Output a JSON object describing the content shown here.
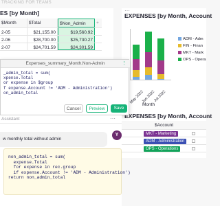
{
  "app": {
    "title": "TRACKING FOR TEAMS"
  },
  "left_panel": {
    "title": "ES [by Month]",
    "columns": [
      "$Month",
      "$Total",
      "$Non_Admin",
      "+"
    ],
    "rows": [
      {
        "month": "2-05",
        "total": "$21,155.00",
        "non_admin": "$19,560.92"
      },
      {
        "month": "2-06",
        "total": "$28,700.00",
        "non_admin": "$25,730.27"
      },
      {
        "month": "2-07",
        "total": "$24,701.59",
        "non_admin": "$24,301.59"
      }
    ]
  },
  "chart_panel": {
    "title": "EXPENSES [by Month, Account",
    "menu_icon": "more-dots-icon"
  },
  "chart_data": {
    "type": "bar",
    "categories": [
      "May 2022",
      "Jun 2022",
      "Jul 2022"
    ],
    "series": [
      {
        "name": "ADM - Adm",
        "color": "#74a7e0",
        "values": [
          1600,
          3000,
          400
        ]
      },
      {
        "name": "FIN - Finan",
        "color": "#e6bb2c",
        "values": [
          4000,
          4500,
          3000
        ]
      },
      {
        "name": "MKT - Mark",
        "color": "#a23a8a",
        "values": [
          6500,
          9000,
          8000
        ]
      },
      {
        "name": "OPS - Opera",
        "color": "#1bb04a",
        "values": [
          9000,
          12200,
          13300
        ]
      }
    ],
    "xlabel": "Month",
    "legend": "right"
  },
  "dialog": {
    "title": "Expenses_summary_Month.Non-Admin",
    "code_lines": [
      "_admin_total = sum(",
      "xpense.Total",
      "or expense in $group",
      "f expense.Account != 'ADM - Administration')",
      "on_admin_total"
    ],
    "cancel_label": "Cancel",
    "preview_label": "Preview",
    "save_label": "Save"
  },
  "accounts_panel": {
    "title": "EXPENSES [by Month, Account",
    "column": "$Account",
    "rows": [
      {
        "label": "MKT - Marketing",
        "color": "#7b3292"
      },
      {
        "label": "ADM - Administration",
        "color": "#3a4fb3"
      },
      {
        "label": "OPS - Operations",
        "color": "#12a35a"
      }
    ]
  },
  "assistant": {
    "header": "Assistant",
    "user_message": "w monthly total without admin",
    "avatar_initial": "Y",
    "code_lines": [
      "non_admin_total = sum(",
      "  expense.Total",
      "  for expense in rec.group",
      "  if expense.Account != 'ADM - Administration')",
      "return non_admin_total"
    ]
  }
}
